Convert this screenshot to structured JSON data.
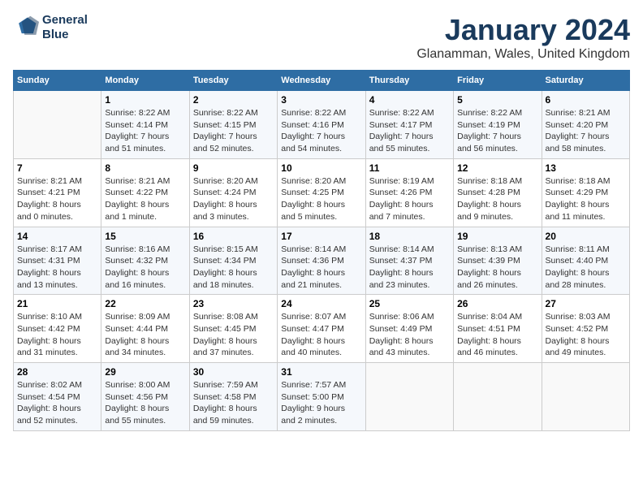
{
  "header": {
    "logo_line1": "General",
    "logo_line2": "Blue",
    "title": "January 2024",
    "subtitle": "Glanamman, Wales, United Kingdom"
  },
  "calendar": {
    "headers": [
      "Sunday",
      "Monday",
      "Tuesday",
      "Wednesday",
      "Thursday",
      "Friday",
      "Saturday"
    ],
    "weeks": [
      [
        {
          "day": "",
          "info": ""
        },
        {
          "day": "1",
          "info": "Sunrise: 8:22 AM\nSunset: 4:14 PM\nDaylight: 7 hours\nand 51 minutes."
        },
        {
          "day": "2",
          "info": "Sunrise: 8:22 AM\nSunset: 4:15 PM\nDaylight: 7 hours\nand 52 minutes."
        },
        {
          "day": "3",
          "info": "Sunrise: 8:22 AM\nSunset: 4:16 PM\nDaylight: 7 hours\nand 54 minutes."
        },
        {
          "day": "4",
          "info": "Sunrise: 8:22 AM\nSunset: 4:17 PM\nDaylight: 7 hours\nand 55 minutes."
        },
        {
          "day": "5",
          "info": "Sunrise: 8:22 AM\nSunset: 4:19 PM\nDaylight: 7 hours\nand 56 minutes."
        },
        {
          "day": "6",
          "info": "Sunrise: 8:21 AM\nSunset: 4:20 PM\nDaylight: 7 hours\nand 58 minutes."
        }
      ],
      [
        {
          "day": "7",
          "info": "Sunrise: 8:21 AM\nSunset: 4:21 PM\nDaylight: 8 hours\nand 0 minutes."
        },
        {
          "day": "8",
          "info": "Sunrise: 8:21 AM\nSunset: 4:22 PM\nDaylight: 8 hours\nand 1 minute."
        },
        {
          "day": "9",
          "info": "Sunrise: 8:20 AM\nSunset: 4:24 PM\nDaylight: 8 hours\nand 3 minutes."
        },
        {
          "day": "10",
          "info": "Sunrise: 8:20 AM\nSunset: 4:25 PM\nDaylight: 8 hours\nand 5 minutes."
        },
        {
          "day": "11",
          "info": "Sunrise: 8:19 AM\nSunset: 4:26 PM\nDaylight: 8 hours\nand 7 minutes."
        },
        {
          "day": "12",
          "info": "Sunrise: 8:18 AM\nSunset: 4:28 PM\nDaylight: 8 hours\nand 9 minutes."
        },
        {
          "day": "13",
          "info": "Sunrise: 8:18 AM\nSunset: 4:29 PM\nDaylight: 8 hours\nand 11 minutes."
        }
      ],
      [
        {
          "day": "14",
          "info": "Sunrise: 8:17 AM\nSunset: 4:31 PM\nDaylight: 8 hours\nand 13 minutes."
        },
        {
          "day": "15",
          "info": "Sunrise: 8:16 AM\nSunset: 4:32 PM\nDaylight: 8 hours\nand 16 minutes."
        },
        {
          "day": "16",
          "info": "Sunrise: 8:15 AM\nSunset: 4:34 PM\nDaylight: 8 hours\nand 18 minutes."
        },
        {
          "day": "17",
          "info": "Sunrise: 8:14 AM\nSunset: 4:36 PM\nDaylight: 8 hours\nand 21 minutes."
        },
        {
          "day": "18",
          "info": "Sunrise: 8:14 AM\nSunset: 4:37 PM\nDaylight: 8 hours\nand 23 minutes."
        },
        {
          "day": "19",
          "info": "Sunrise: 8:13 AM\nSunset: 4:39 PM\nDaylight: 8 hours\nand 26 minutes."
        },
        {
          "day": "20",
          "info": "Sunrise: 8:11 AM\nSunset: 4:40 PM\nDaylight: 8 hours\nand 28 minutes."
        }
      ],
      [
        {
          "day": "21",
          "info": "Sunrise: 8:10 AM\nSunset: 4:42 PM\nDaylight: 8 hours\nand 31 minutes."
        },
        {
          "day": "22",
          "info": "Sunrise: 8:09 AM\nSunset: 4:44 PM\nDaylight: 8 hours\nand 34 minutes."
        },
        {
          "day": "23",
          "info": "Sunrise: 8:08 AM\nSunset: 4:45 PM\nDaylight: 8 hours\nand 37 minutes."
        },
        {
          "day": "24",
          "info": "Sunrise: 8:07 AM\nSunset: 4:47 PM\nDaylight: 8 hours\nand 40 minutes."
        },
        {
          "day": "25",
          "info": "Sunrise: 8:06 AM\nSunset: 4:49 PM\nDaylight: 8 hours\nand 43 minutes."
        },
        {
          "day": "26",
          "info": "Sunrise: 8:04 AM\nSunset: 4:51 PM\nDaylight: 8 hours\nand 46 minutes."
        },
        {
          "day": "27",
          "info": "Sunrise: 8:03 AM\nSunset: 4:52 PM\nDaylight: 8 hours\nand 49 minutes."
        }
      ],
      [
        {
          "day": "28",
          "info": "Sunrise: 8:02 AM\nSunset: 4:54 PM\nDaylight: 8 hours\nand 52 minutes."
        },
        {
          "day": "29",
          "info": "Sunrise: 8:00 AM\nSunset: 4:56 PM\nDaylight: 8 hours\nand 55 minutes."
        },
        {
          "day": "30",
          "info": "Sunrise: 7:59 AM\nSunset: 4:58 PM\nDaylight: 8 hours\nand 59 minutes."
        },
        {
          "day": "31",
          "info": "Sunrise: 7:57 AM\nSunset: 5:00 PM\nDaylight: 9 hours\nand 2 minutes."
        },
        {
          "day": "",
          "info": ""
        },
        {
          "day": "",
          "info": ""
        },
        {
          "day": "",
          "info": ""
        }
      ]
    ]
  }
}
